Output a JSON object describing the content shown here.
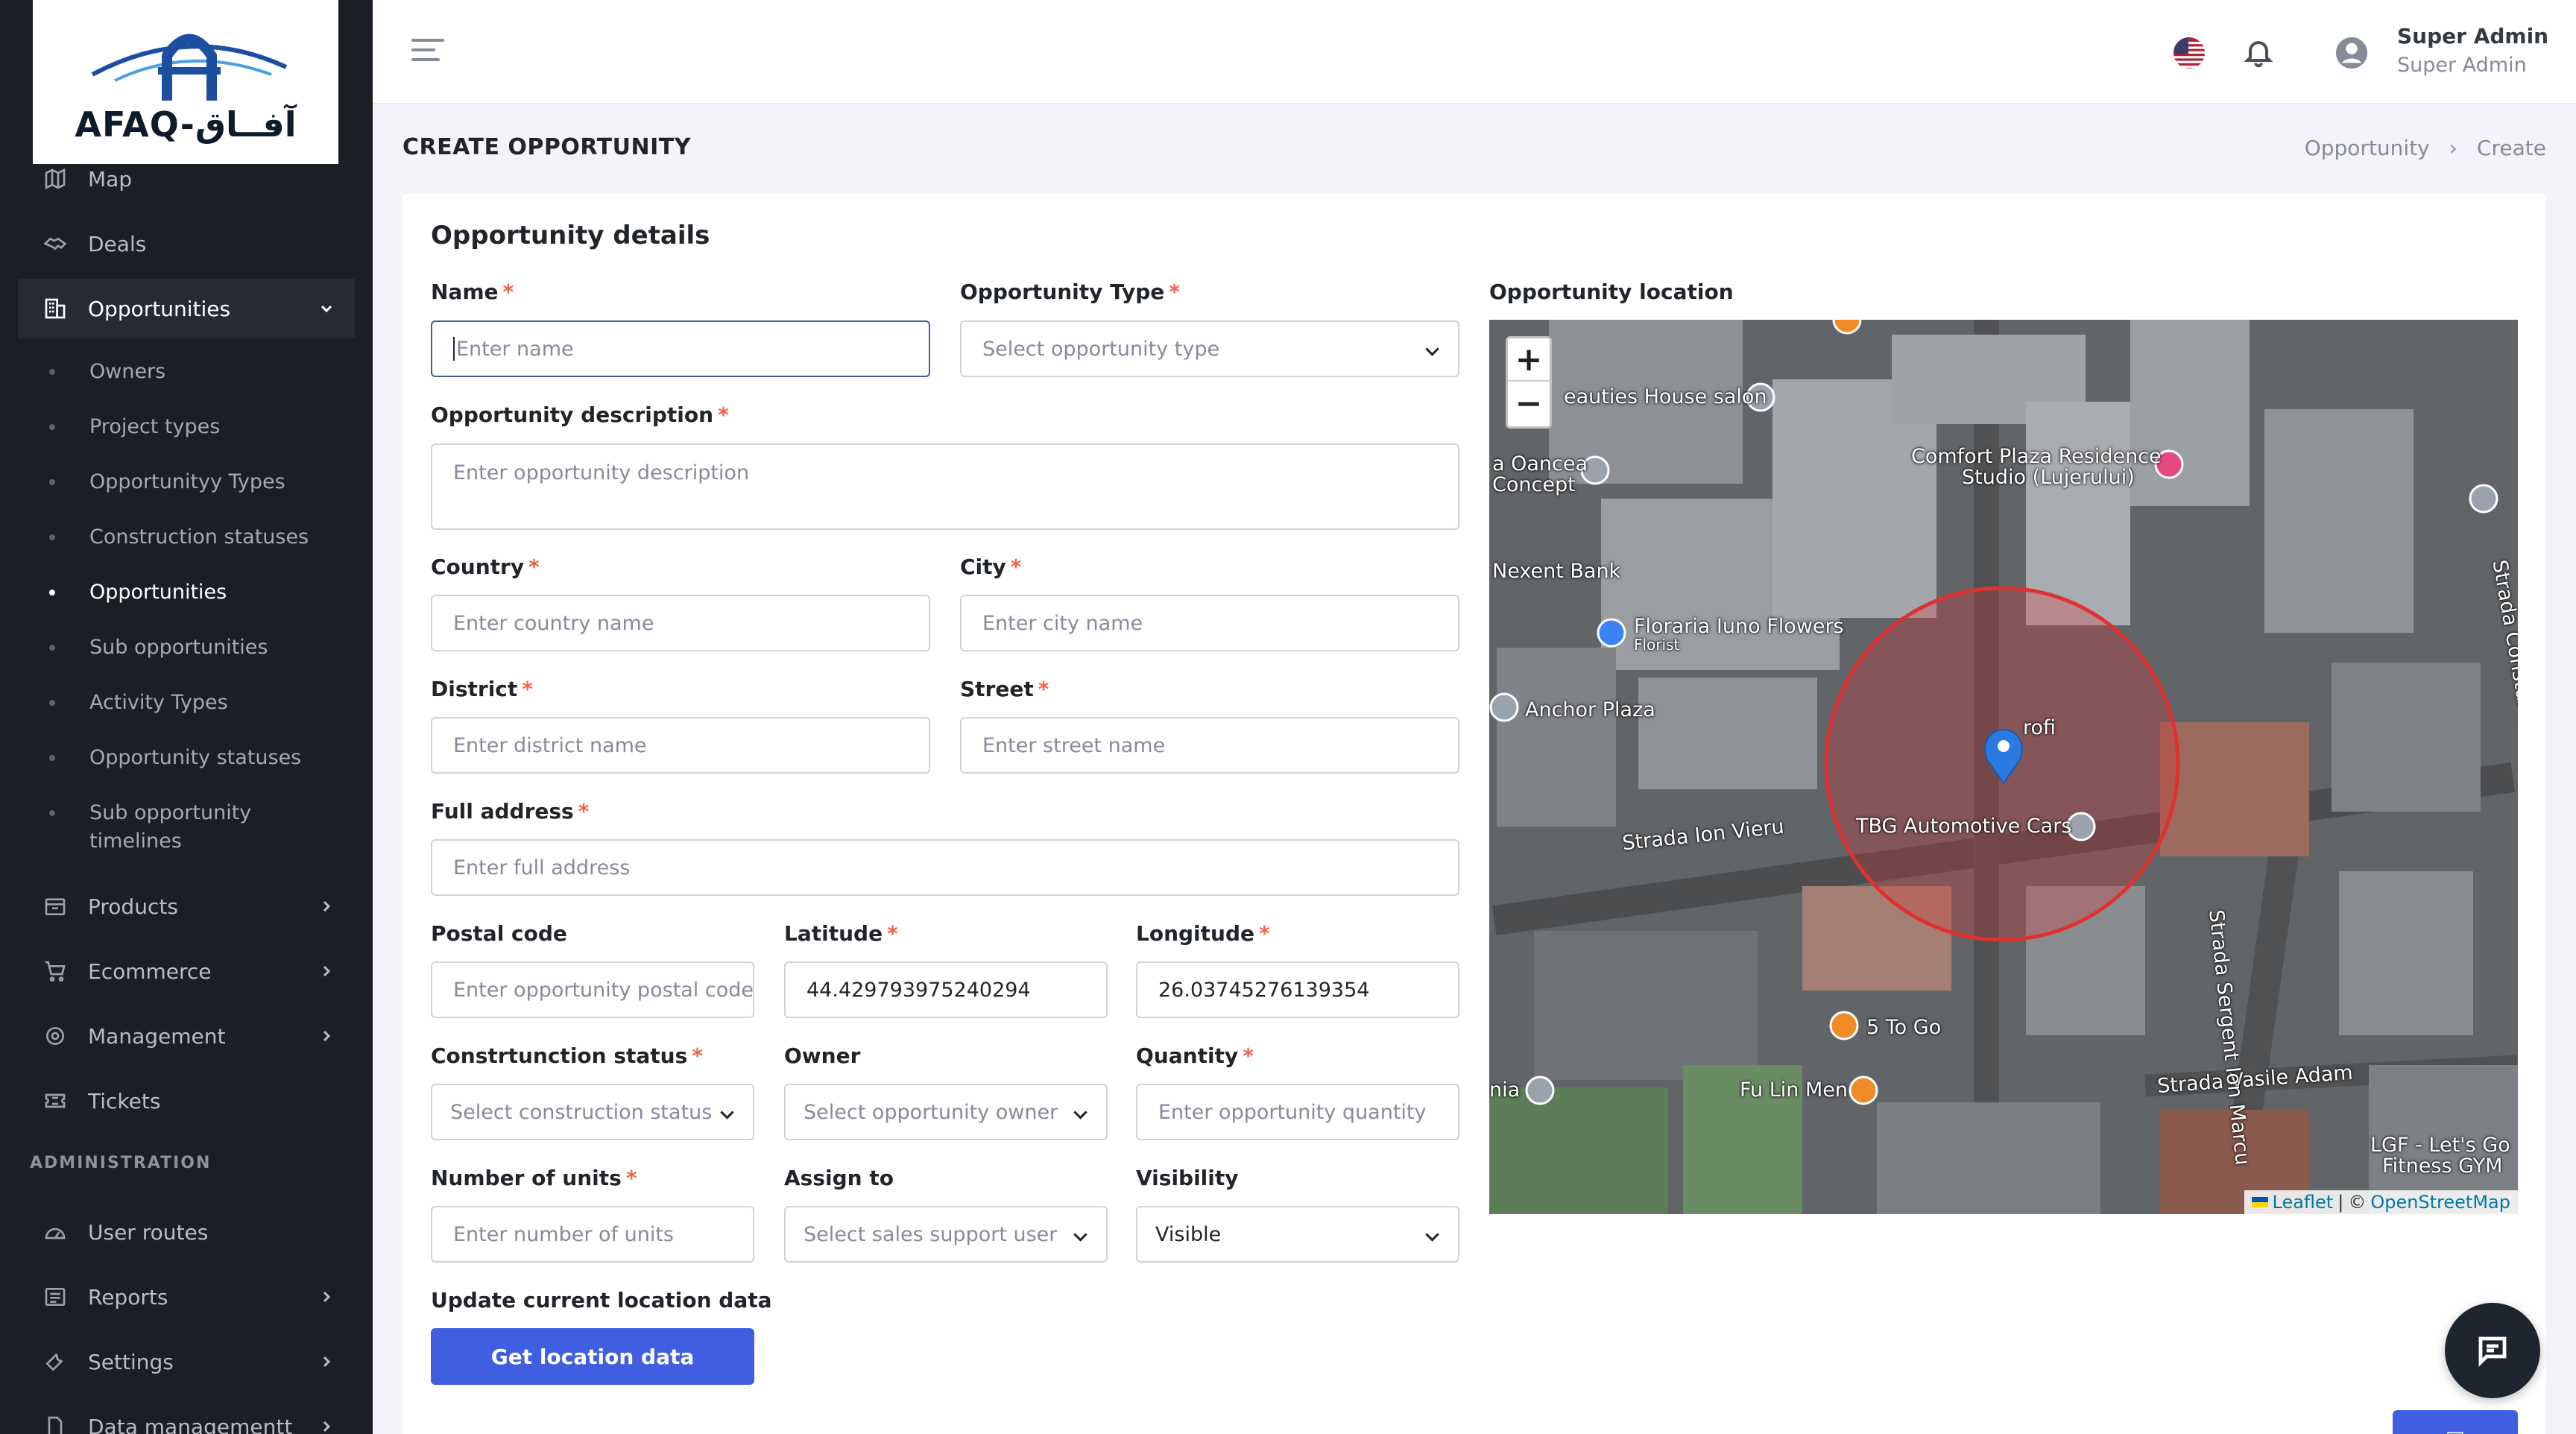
{
  "app": {
    "logo_text": "AFAQ-آفــاق"
  },
  "topbar": {
    "user_name": "Super Admin",
    "user_role": "Super Admin",
    "icons": [
      "menu-icon",
      "us-flag-icon",
      "bell-icon",
      "user-avatar-icon"
    ]
  },
  "sidebar": {
    "items": [
      {
        "label": "Map",
        "icon": "map-icon"
      },
      {
        "label": "Deals",
        "icon": "handshake-icon"
      },
      {
        "label": "Opportunities",
        "icon": "building-icon",
        "expanded": true
      },
      {
        "label": "Products",
        "icon": "box-icon"
      },
      {
        "label": "Ecommerce",
        "icon": "cart-icon"
      },
      {
        "label": "Management",
        "icon": "gear-icon"
      },
      {
        "label": "Tickets",
        "icon": "ticket-icon"
      }
    ],
    "subitems": [
      "Owners",
      "Project types",
      "Opportunityy Types",
      "Construction statuses",
      "Opportunities",
      "Sub opportunities",
      "Activity Types",
      "Opportunity statuses",
      "Sub opportunity timelines"
    ],
    "admin_label": "ADMINISTRATION",
    "admin_items": [
      {
        "label": "User routes",
        "icon": "gauge-icon"
      },
      {
        "label": "Reports",
        "icon": "list-icon"
      },
      {
        "label": "Settings",
        "icon": "wrench-icon"
      },
      {
        "label": "Data managementt",
        "icon": "file-icon"
      }
    ]
  },
  "page": {
    "title": "CREATE OPPORTUNITY",
    "breadcrumb": [
      "Opportunity",
      "Create"
    ]
  },
  "form": {
    "section_title": "Opportunity details",
    "name": {
      "label": "Name",
      "placeholder": "Enter name"
    },
    "type": {
      "label": "Opportunity Type",
      "placeholder": "Select opportunity type"
    },
    "description": {
      "label": "Opportunity description",
      "placeholder": "Enter opportunity description"
    },
    "country": {
      "label": "Country",
      "placeholder": "Enter country name"
    },
    "city": {
      "label": "City",
      "placeholder": "Enter city name"
    },
    "district": {
      "label": "District",
      "placeholder": "Enter district name"
    },
    "street": {
      "label": "Street",
      "placeholder": "Enter street name"
    },
    "full_address": {
      "label": "Full address",
      "placeholder": "Enter full address"
    },
    "postal_code": {
      "label": "Postal code",
      "placeholder": "Enter opportunity postal code"
    },
    "latitude": {
      "label": "Latitude",
      "value": "44.429793975240294"
    },
    "longitude": {
      "label": "Longitude",
      "value": "26.03745276139354"
    },
    "construction_status": {
      "label": "Constrtunction status",
      "placeholder": "Select construction status"
    },
    "owner": {
      "label": "Owner",
      "placeholder": "Select opportunity owner"
    },
    "quantity": {
      "label": "Quantity",
      "placeholder": "Enter opportunity quantity"
    },
    "units": {
      "label": "Number of units",
      "placeholder": "Enter number of units"
    },
    "assign_to": {
      "label": "Assign to",
      "placeholder": "Select sales support user"
    },
    "visibility": {
      "label": "Visibility",
      "value": "Visible"
    },
    "update_location": {
      "label": "Update current location data",
      "button": "Get location data"
    }
  },
  "map": {
    "label": "Opportunity location",
    "zoom_in": "+",
    "zoom_out": "−",
    "place_labels": [
      "eauties House salon",
      "a Oancea",
      "Concept",
      "Comfort Plaza Residence",
      "Studio (Lujerului)",
      "Nexent Bank",
      "Floraria Iuno Flowers",
      "Florist",
      "Anchor Plaza",
      "rofi",
      "Strada Ion Vieru",
      "TBG Automotive Cars",
      "5 To Go",
      "Fu Lin Men",
      "nia",
      "Strada Vasile Adam",
      "LGF - Let's Go",
      "Fitness GYM",
      "Strada Sergent Ion Marcu",
      "Strada Constantin"
    ],
    "attribution": {
      "leaflet": "Leaflet",
      "sep": "|",
      "copy": "©",
      "osm": "OpenStreetMap"
    }
  },
  "colors": {
    "primary": "#405ee0",
    "sidebar": "#1b1e24",
    "required": "#f06548",
    "circle": "#e03131"
  }
}
